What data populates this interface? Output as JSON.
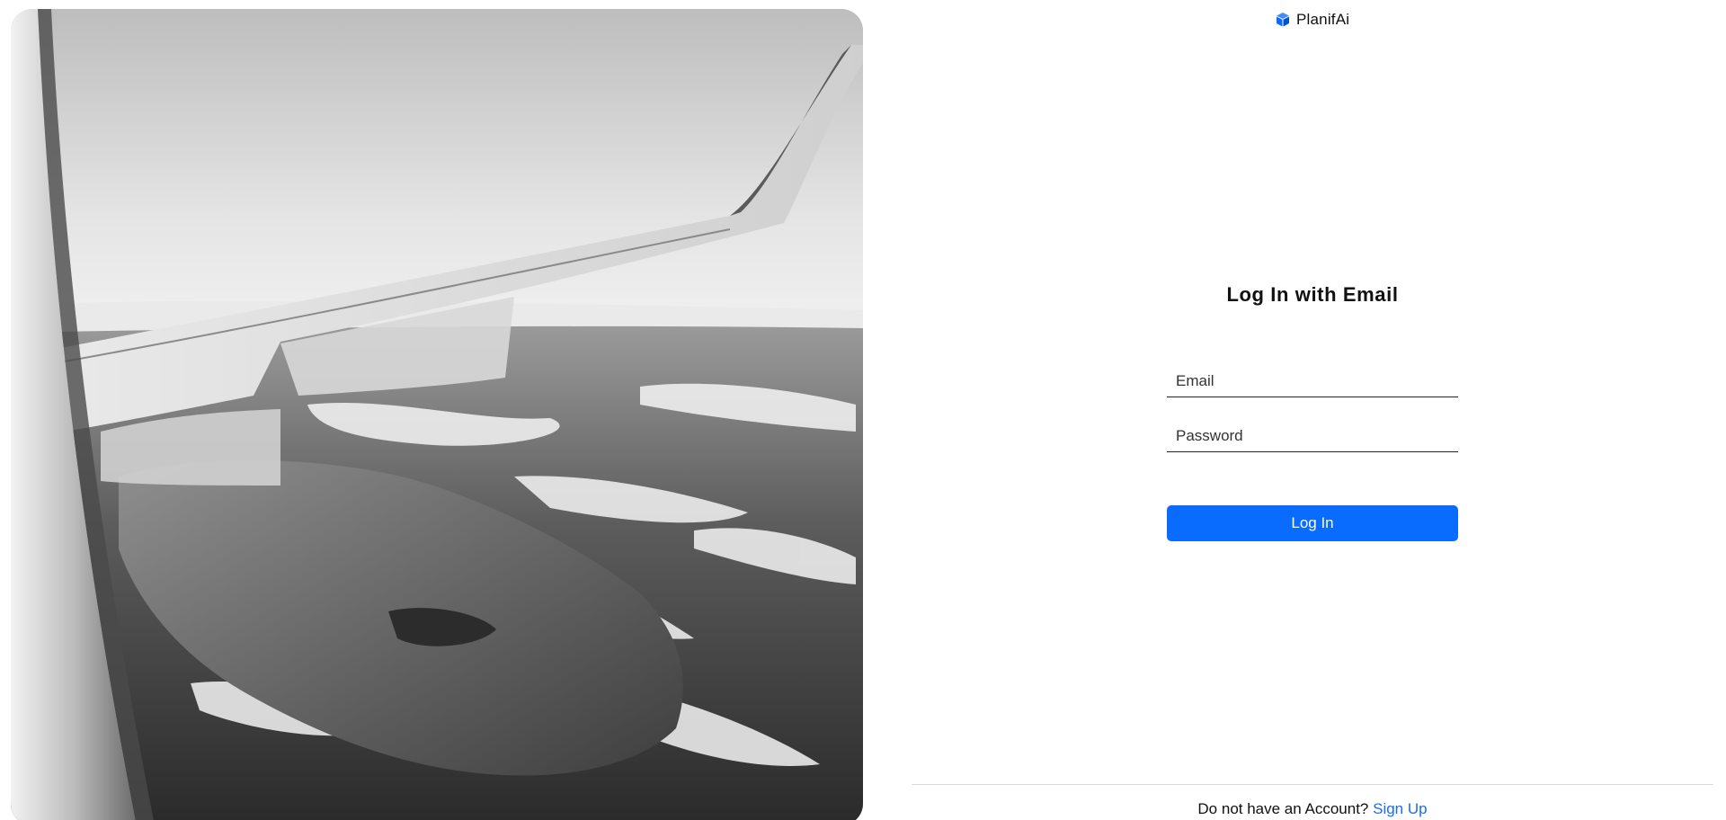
{
  "brand": {
    "name": "PlanifAi",
    "icon": "cube-icon",
    "icon_color": "#0a6cff"
  },
  "login": {
    "title": "Log In with Email",
    "email_placeholder": "Email",
    "email_value": "",
    "password_placeholder": "Password",
    "password_value": "",
    "submit_label": "Log In",
    "accent_color": "#0a6cff"
  },
  "footer": {
    "prompt": "Do not have an Account?",
    "signup_label": "Sign Up",
    "link_color": "#1a6cf0"
  },
  "hero": {
    "image_subject": "airplane-wing-window-view"
  }
}
